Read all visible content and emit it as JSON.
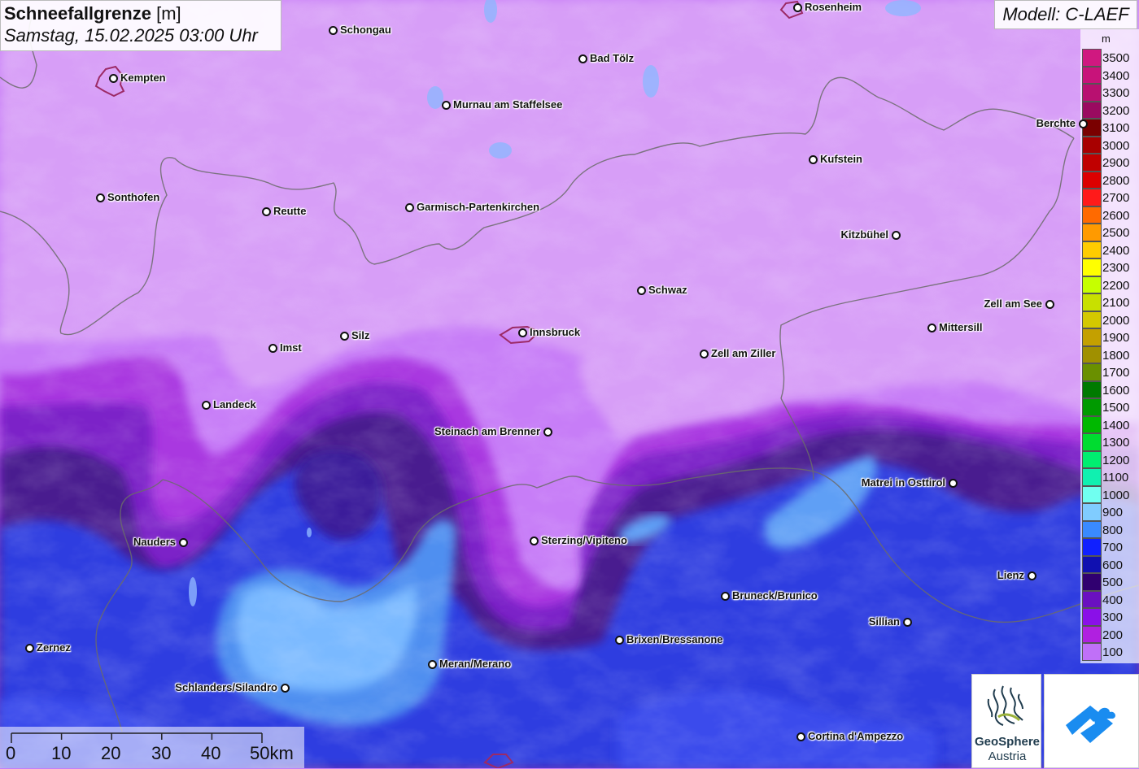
{
  "title": {
    "main": "Schneefallgrenze",
    "unit": "[m]",
    "datetime": "Samstag, 15.02.2025 03:00 Uhr"
  },
  "model": "Modell: C-LAEF",
  "legend": {
    "unit": "m",
    "entries": [
      {
        "label": "3500",
        "color": "#d01880"
      },
      {
        "label": "3400",
        "color": "#c8137a"
      },
      {
        "label": "3300",
        "color": "#b81070"
      },
      {
        "label": "3200",
        "color": "#9a0a60"
      },
      {
        "label": "3100",
        "color": "#7a0000"
      },
      {
        "label": "3000",
        "color": "#a80000"
      },
      {
        "label": "2900",
        "color": "#c00000"
      },
      {
        "label": "2800",
        "color": "#dc0000"
      },
      {
        "label": "2700",
        "color": "#ff1a1a"
      },
      {
        "label": "2600",
        "color": "#ff6a00"
      },
      {
        "label": "2500",
        "color": "#ff9a00"
      },
      {
        "label": "2400",
        "color": "#ffcc00"
      },
      {
        "label": "2300",
        "color": "#ffff00"
      },
      {
        "label": "2200",
        "color": "#c6ff00"
      },
      {
        "label": "2100",
        "color": "#c8e000"
      },
      {
        "label": "2000",
        "color": "#d4c800"
      },
      {
        "label": "1900",
        "color": "#c4a000"
      },
      {
        "label": "1800",
        "color": "#a09000"
      },
      {
        "label": "1700",
        "color": "#6a9000"
      },
      {
        "label": "1600",
        "color": "#007a00"
      },
      {
        "label": "1500",
        "color": "#009a00"
      },
      {
        "label": "1400",
        "color": "#00b800"
      },
      {
        "label": "1300",
        "color": "#00dc30"
      },
      {
        "label": "1200",
        "color": "#00ee70"
      },
      {
        "label": "1100",
        "color": "#10f0b0"
      },
      {
        "label": "1000",
        "color": "#70fff0"
      },
      {
        "label": "900",
        "color": "#80ccff"
      },
      {
        "label": "800",
        "color": "#3a8aff"
      },
      {
        "label": "700",
        "color": "#1020ff"
      },
      {
        "label": "600",
        "color": "#1010b0"
      },
      {
        "label": "500",
        "color": "#300070"
      },
      {
        "label": "400",
        "color": "#6a10c0"
      },
      {
        "label": "300",
        "color": "#8a10e8"
      },
      {
        "label": "200",
        "color": "#b020e0"
      },
      {
        "label": "100",
        "color": "#c070f8"
      }
    ]
  },
  "cities": [
    {
      "name": "Schongau",
      "side": "right"
    },
    {
      "name": "Rosenheim",
      "side": "right"
    },
    {
      "name": "Kempten",
      "side": "right"
    },
    {
      "name": "Bad Tölz",
      "side": "right"
    },
    {
      "name": "Murnau am Staffelsee",
      "side": "right"
    },
    {
      "name": "Berchte",
      "side": "left"
    },
    {
      "name": "Kufstein",
      "side": "right"
    },
    {
      "name": "Sonthofen",
      "side": "right"
    },
    {
      "name": "Reutte",
      "side": "right"
    },
    {
      "name": "Garmisch-Partenkirchen",
      "side": "right"
    },
    {
      "name": "Kitzbühel",
      "side": "left"
    },
    {
      "name": "Schwaz",
      "side": "right"
    },
    {
      "name": "Zell am See",
      "side": "left"
    },
    {
      "name": "Mittersill",
      "side": "right"
    },
    {
      "name": "Silz",
      "side": "right"
    },
    {
      "name": "Innsbruck",
      "side": "right"
    },
    {
      "name": "Imst",
      "side": "right"
    },
    {
      "name": "Zell am Ziller",
      "side": "right"
    },
    {
      "name": "Landeck",
      "side": "right"
    },
    {
      "name": "Steinach am Brenner",
      "side": "left"
    },
    {
      "name": "Matrei in Osttirol",
      "side": "left"
    },
    {
      "name": "Nauders",
      "side": "left"
    },
    {
      "name": "Sterzing/Vipiteno",
      "side": "right"
    },
    {
      "name": "Lienz",
      "side": "left"
    },
    {
      "name": "Bruneck/Brunico",
      "side": "right"
    },
    {
      "name": "Sillian",
      "side": "left"
    },
    {
      "name": "Brixen/Bressanone",
      "side": "right"
    },
    {
      "name": "Zernez",
      "side": "right"
    },
    {
      "name": "Meran/Merano",
      "side": "right"
    },
    {
      "name": "Schlanders/Silandro",
      "side": "left"
    },
    {
      "name": "Cortina d'Ampezzo",
      "side": "right"
    }
  ],
  "scale": {
    "labels": [
      "0",
      "10",
      "20",
      "30",
      "40",
      "50km"
    ]
  },
  "logos": {
    "geosphere_line1": "GeoSphere",
    "geosphere_line2": "Austria"
  }
}
